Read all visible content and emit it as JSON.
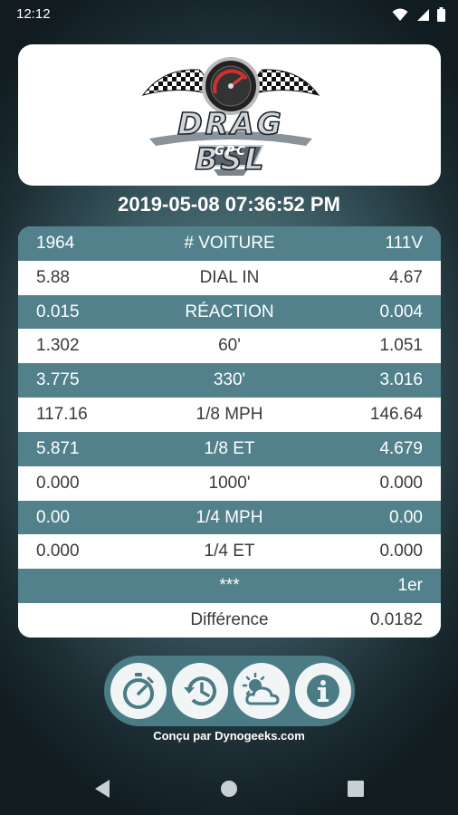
{
  "status_bar": {
    "time": "12:12"
  },
  "logo": {
    "title": "DRAG BSL",
    "subtitle": "GPC"
  },
  "timestamp": "2019-05-08 07:36:52 PM",
  "rows": [
    {
      "left": "1964",
      "label": "# VOITURE",
      "right": "111V"
    },
    {
      "left": "5.88",
      "label": "DIAL IN",
      "right": "4.67"
    },
    {
      "left": "0.015",
      "label": "RÉACTION",
      "right": "0.004"
    },
    {
      "left": "1.302",
      "label": "60'",
      "right": "1.051"
    },
    {
      "left": "3.775",
      "label": "330'",
      "right": "3.016"
    },
    {
      "left": "117.16",
      "label": "1/8 MPH",
      "right": "146.64"
    },
    {
      "left": "5.871",
      "label": "1/8 ET",
      "right": "4.679"
    },
    {
      "left": "0.000",
      "label": "1000'",
      "right": "0.000"
    },
    {
      "left": "0.00",
      "label": "1/4 MPH",
      "right": "0.00"
    },
    {
      "left": "0.000",
      "label": "1/4 ET",
      "right": "0.000"
    },
    {
      "left": "",
      "label": "***",
      "right": "1er"
    },
    {
      "left": "",
      "label": "Différence",
      "right": "0.0182"
    }
  ],
  "toolbar": {
    "buttons": [
      {
        "icon": "stopwatch-icon"
      },
      {
        "icon": "history-icon"
      },
      {
        "icon": "weather-icon"
      },
      {
        "icon": "info-icon"
      }
    ]
  },
  "credit": "Conçu par Dynogeeks.com",
  "colors": {
    "teal": "#52818b",
    "toolbar": "#4b7c86"
  }
}
